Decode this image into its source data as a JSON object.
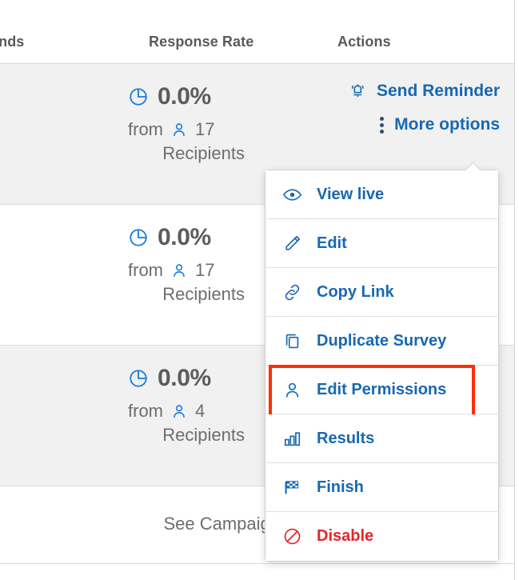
{
  "table": {
    "headers": {
      "trends": "ends",
      "response_rate": "Response Rate",
      "actions": "Actions"
    },
    "rows": [
      {
        "rate": "0.0%",
        "from_label": "from",
        "recipients_count": "17",
        "recipients_label": "Recipients",
        "actions": [
          {
            "label": "Send Reminder",
            "icon": "bell-icon"
          },
          {
            "label": "More options",
            "icon": "vertical-dots-icon"
          }
        ]
      },
      {
        "rate": "0.0%",
        "from_label": "from",
        "recipients_count": "17",
        "recipients_label": "Recipients",
        "actions": []
      },
      {
        "rate": "0.0%",
        "from_label": "from",
        "recipients_count": "4",
        "recipients_label": "Recipients",
        "actions": []
      }
    ],
    "footer": {
      "see_campaign": "See Campaign"
    }
  },
  "dropdown_menu": {
    "items": [
      {
        "label": "View live",
        "icon": "eye-icon",
        "danger": false,
        "highlighted": false
      },
      {
        "label": "Edit",
        "icon": "pencil-icon",
        "danger": false,
        "highlighted": false
      },
      {
        "label": "Copy Link",
        "icon": "link-icon",
        "danger": false,
        "highlighted": false
      },
      {
        "label": "Duplicate Survey",
        "icon": "duplicate-icon",
        "danger": false,
        "highlighted": false
      },
      {
        "label": "Edit Permissions",
        "icon": "person-icon",
        "danger": false,
        "highlighted": true
      },
      {
        "label": "Results",
        "icon": "bar-chart-icon",
        "danger": false,
        "highlighted": false
      },
      {
        "label": "Finish",
        "icon": "checkered-flag-icon",
        "danger": false,
        "highlighted": false
      },
      {
        "label": "Disable",
        "icon": "prohibition-icon",
        "danger": true,
        "highlighted": false
      }
    ]
  },
  "colors": {
    "link_blue": "#1768b3",
    "icon_blue": "#1a7ae0",
    "danger_red": "#e3262b",
    "highlight_red": "#ff2d00",
    "row_alt_bg": "#f1f1f1",
    "text_gray": "#6d6d6d",
    "header_gray": "#5a5a5a"
  }
}
